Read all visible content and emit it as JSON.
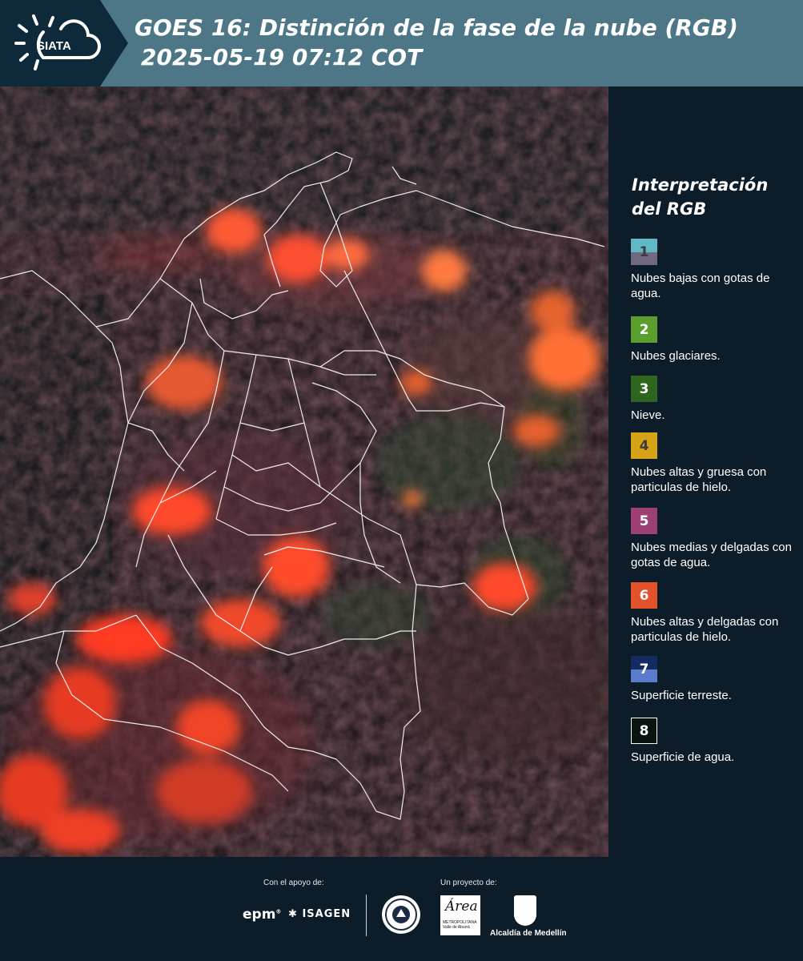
{
  "header": {
    "logo_text": "SIATA",
    "title_line1": "GOES 16: Distinción de la fase de la nube (RGB)",
    "title_line2": "2025-05-19 07:12 COT"
  },
  "legend": {
    "title": "Interpretación del RGB",
    "items": [
      {
        "number": "1",
        "label": "Nubes bajas con gotas de agua.",
        "color_top": "#5fb8c4",
        "color_bottom": "#6f6a82"
      },
      {
        "number": "2",
        "label": "Nubes glaciares.",
        "color_top": "#5a9e2e",
        "color_bottom": "#5a9e2e"
      },
      {
        "number": "3",
        "label": "Nieve.",
        "color_top": "#2e6620",
        "color_bottom": "#2e6620"
      },
      {
        "number": "4",
        "label": "Nubes altas y gruesa con particulas de hielo.",
        "color_top": "#d6a317",
        "color_bottom": "#d6a317"
      },
      {
        "number": "5",
        "label": "Nubes medias y delgadas con gotas de agua.",
        "color_top": "#9c3f74",
        "color_bottom": "#9c3f74"
      },
      {
        "number": "6",
        "label": "Nubes altas y delgadas con particulas de hielo.",
        "color_top": "#e3522b",
        "color_bottom": "#e3522b"
      },
      {
        "number": "7",
        "label": "Superficie terreste.",
        "color_top": "#152a62",
        "color_bottom": "#5a7ccc"
      },
      {
        "number": "8",
        "label": "Superficie de agua.",
        "color_top": "#0a1410",
        "color_bottom": "#0a1410"
      }
    ]
  },
  "footer": {
    "support_caption": "Con el apoyo de:",
    "project_caption": "Un proyecto de:",
    "epm": "epm",
    "isagen": "ISAGEN",
    "area_script": "Área",
    "area_small": "METROPOLITANA Valle de Aburrá",
    "alcaldia": "Alcaldía de Medellín"
  },
  "colors": {
    "header_bg": "#4d7686",
    "logo_panel_bg": "#0e2a3a",
    "page_bg": "#0c1c28",
    "cloud_high_thin_ice": "#ff4a2a"
  }
}
